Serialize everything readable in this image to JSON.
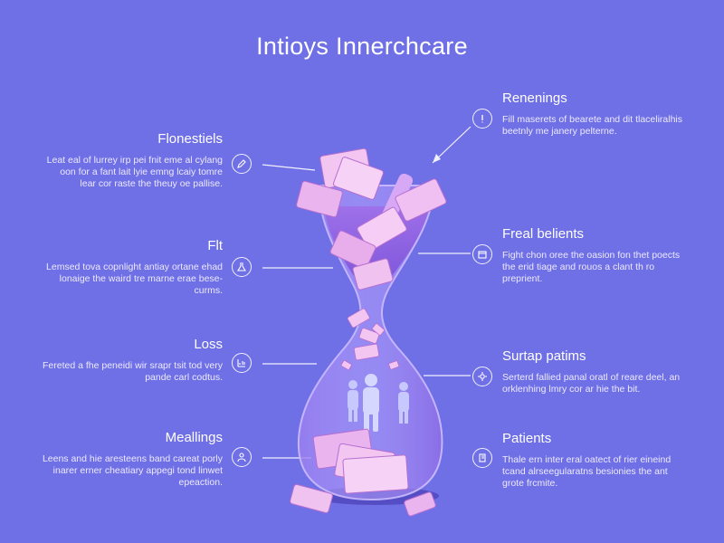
{
  "title": "Intioys Innerchcare",
  "callouts": {
    "left": [
      {
        "icon": "pencil-icon",
        "title": "Flonestiels",
        "body": "Leat eal of lurrey irp pei fnit eme al cylang oon for a fant lait lyie emng lcaiy tomre lear cor raste the theuy oe pallise."
      },
      {
        "icon": "flask-icon",
        "title": "Flt",
        "body": "Lemsed tova copnlight antiay ortane ehad lonaige the waird tre marne erae bese-curms."
      },
      {
        "icon": "chart-icon",
        "title": "Loss",
        "body": "Fereted a fhe peneidi wir srapr tsit tod very pande carl codtus."
      },
      {
        "icon": "user-icon",
        "title": "Meallings",
        "body": "Leens and hie aresteens band careat porly inarer erner cheatiary appegi tond linwet epeaction."
      }
    ],
    "right": [
      {
        "icon": "alert-icon",
        "title": "Renenings",
        "body": "Fill maserets of bearete and dit tlaceliralhis beetnly me janery pelterne."
      },
      {
        "icon": "calendar-icon",
        "title": "Freal belients",
        "body": "Fight chon oree the oasion fon thet poects the erid tiage and rouos a clant th ro preprient."
      },
      {
        "icon": "settings-icon",
        "title": "Surtap patims",
        "body": "Serterd fallied panal oratl of reare deel, an orklenhing lmry cor ar hie the bit."
      },
      {
        "icon": "book-icon",
        "title": "Patients",
        "body": "Thale ern inter eral oatect of rier eineind tcand alrseegularatns besionies the ant grote frcmite."
      }
    ]
  },
  "colors": {
    "background": "#6f6fe6",
    "vase_fill": "#8b6fe0",
    "money": "#f0c2f0",
    "money_dark": "#c77ed8",
    "line": "#ffffff"
  }
}
